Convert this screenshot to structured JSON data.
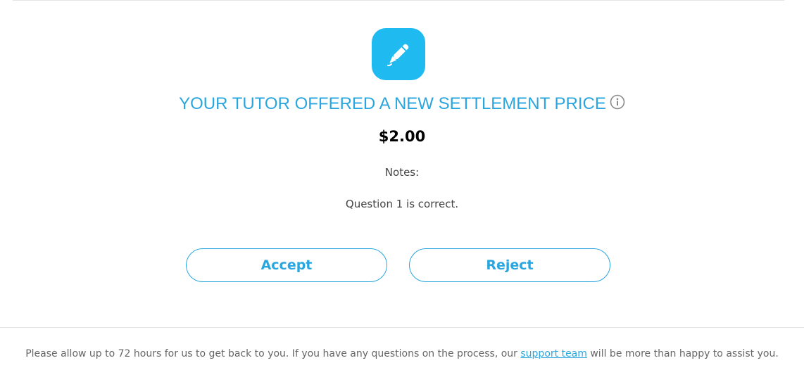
{
  "header": {
    "icon": "pen-icon",
    "title": "YOUR TUTOR OFFERED A NEW SETTLEMENT PRICE",
    "info_icon": "info-icon"
  },
  "offer": {
    "price": "$2.00",
    "notes_label": "Notes:",
    "notes_text": "Question 1 is correct."
  },
  "actions": {
    "accept_label": "Accept",
    "reject_label": "Reject"
  },
  "footer": {
    "text_before": "Please allow up to 72 hours for us to get back to you. If you have any questions on the process, our ",
    "link_label": "support team",
    "text_after": " will be more than happy to assist you."
  },
  "colors": {
    "accent": "#2aa6df",
    "icon_bg": "#1ebaf0",
    "text": "#444444",
    "muted": "#666666"
  }
}
